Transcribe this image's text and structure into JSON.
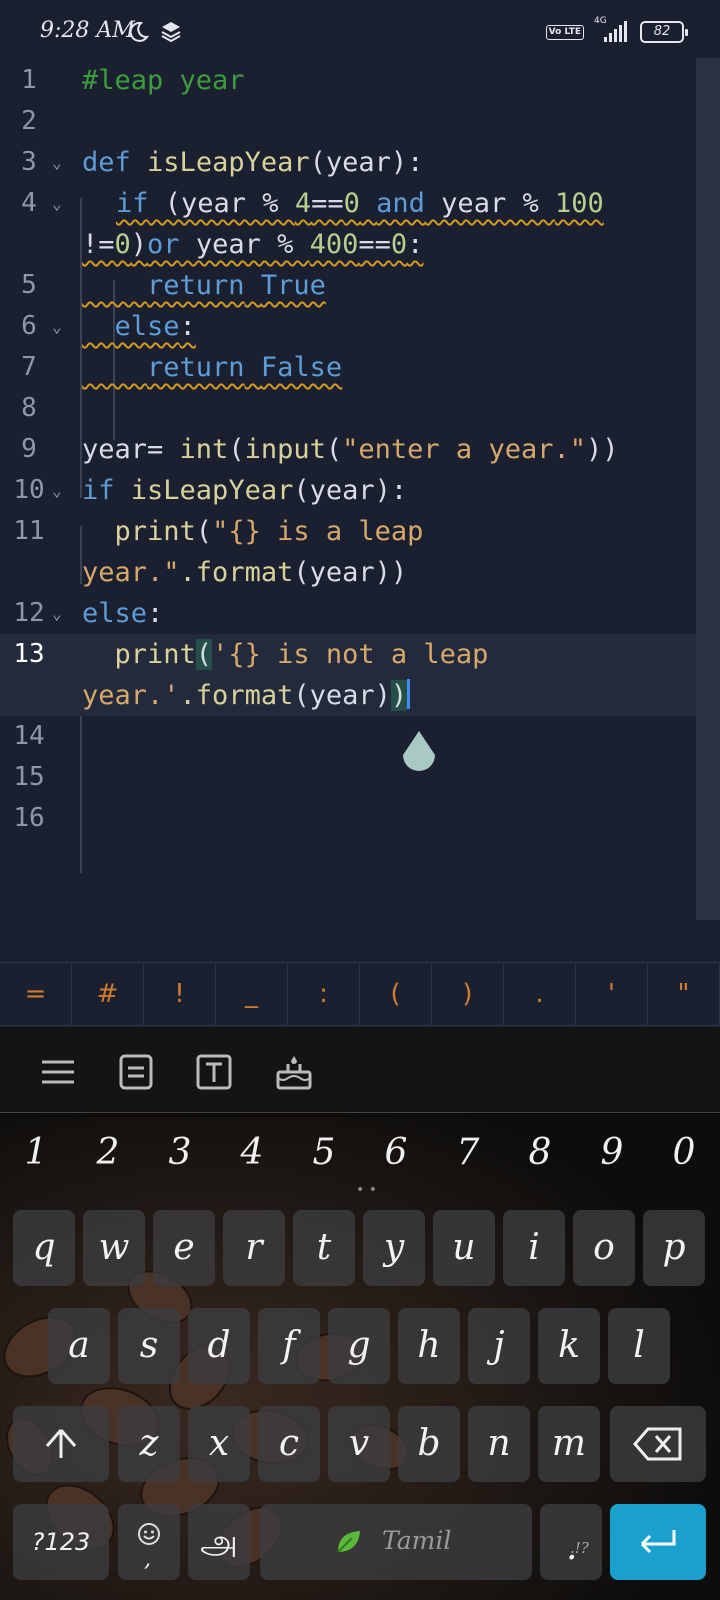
{
  "status_bar": {
    "time": "9:28 AM",
    "icons": [
      "moon-icon",
      "layers-icon",
      "volte-icon",
      "signal-icon",
      "battery-icon"
    ],
    "network": "4G",
    "volte": "Vo LTE",
    "battery": "82"
  },
  "editor": {
    "lines": [
      {
        "n": "1"
      },
      {
        "n": "2"
      },
      {
        "n": "3"
      },
      {
        "n": "4"
      },
      {
        "n": "5"
      },
      {
        "n": "6"
      },
      {
        "n": "7"
      },
      {
        "n": "8"
      },
      {
        "n": "9"
      },
      {
        "n": "10"
      },
      {
        "n": "11"
      },
      {
        "n": "12"
      },
      {
        "n": "13"
      },
      {
        "n": "14"
      },
      {
        "n": "15"
      },
      {
        "n": "16"
      }
    ],
    "tokens": {
      "l1_comment": "#leap year",
      "l3_def": "def",
      "l3_name": "isLeapYear",
      "l3_rest": "(year):",
      "l4_if": "if",
      "l4_a": " (year % ",
      "l4_4": "4",
      "l4_eq": "==",
      "l4_0": "0",
      "l4_and": "and",
      "l4_b": " year % ",
      "l4_100": "100",
      "l4w_ne": "!=",
      "l4w_0": "0",
      "l4w_close": ")",
      "l4w_or": "or",
      "l4w_b": " year % ",
      "l4w_400": "400",
      "l4w_eq": "==",
      "l4w_0b": "0",
      "l4w_colon": ":",
      "l5_return": "return",
      "l5_true": "True",
      "l6_else": "else",
      "l6_colon": ":",
      "l7_return": "return",
      "l7_false": "False",
      "l9_a": "year= ",
      "l9_int": "int",
      "l9_p": "(",
      "l9_input": "input",
      "l9_p2": "(",
      "l9_str": "\"enter a year.\"",
      "l9_end": "))",
      "l10_if": "if",
      "l10_name": "isLeapYear",
      "l10_rest": "(year):",
      "l11_print": "print",
      "l11_p": "(",
      "l11_str": "\"{} is a leap",
      "l11w_str": "year.\"",
      "l11w_format": ".format",
      "l11w_rest": "(year))",
      "l12_else": "else",
      "l12_colon": ":",
      "l13_print": "print",
      "l13_p": "(",
      "l13_str": "'{} is not a leap",
      "l13w_str": "year.'",
      "l13w_format": ".format",
      "l13w_rest": "(year)",
      "l13w_close": ")"
    }
  },
  "symbol_bar": [
    "=",
    "#",
    "!",
    "_",
    ":",
    "(",
    ")",
    ".",
    "'",
    "\""
  ],
  "keyboard": {
    "toolbar_icons": [
      "menu-icon",
      "clipboard-icon",
      "text-format-icon",
      "cake-icon"
    ],
    "numbers": [
      "1",
      "2",
      "3",
      "4",
      "5",
      "6",
      "7",
      "8",
      "9",
      "0"
    ],
    "row1": [
      "q",
      "w",
      "e",
      "r",
      "t",
      "y",
      "u",
      "i",
      "o",
      "p"
    ],
    "row2": [
      "a",
      "s",
      "d",
      "f",
      "g",
      "h",
      "j",
      "k",
      "l"
    ],
    "row3": [
      "z",
      "x",
      "c",
      "v",
      "b",
      "n",
      "m"
    ],
    "symbols_key": "?123",
    "emoji_key_sub": ",",
    "lang_key": "அ",
    "space_label": "Tamil",
    "period_key": ".",
    "period_alt": ".!?",
    "colors": {
      "accent": "#1aa0cc",
      "symbol": "#cf7b2f",
      "keyword": "#5e9cd6",
      "string": "#d7a86a"
    }
  }
}
